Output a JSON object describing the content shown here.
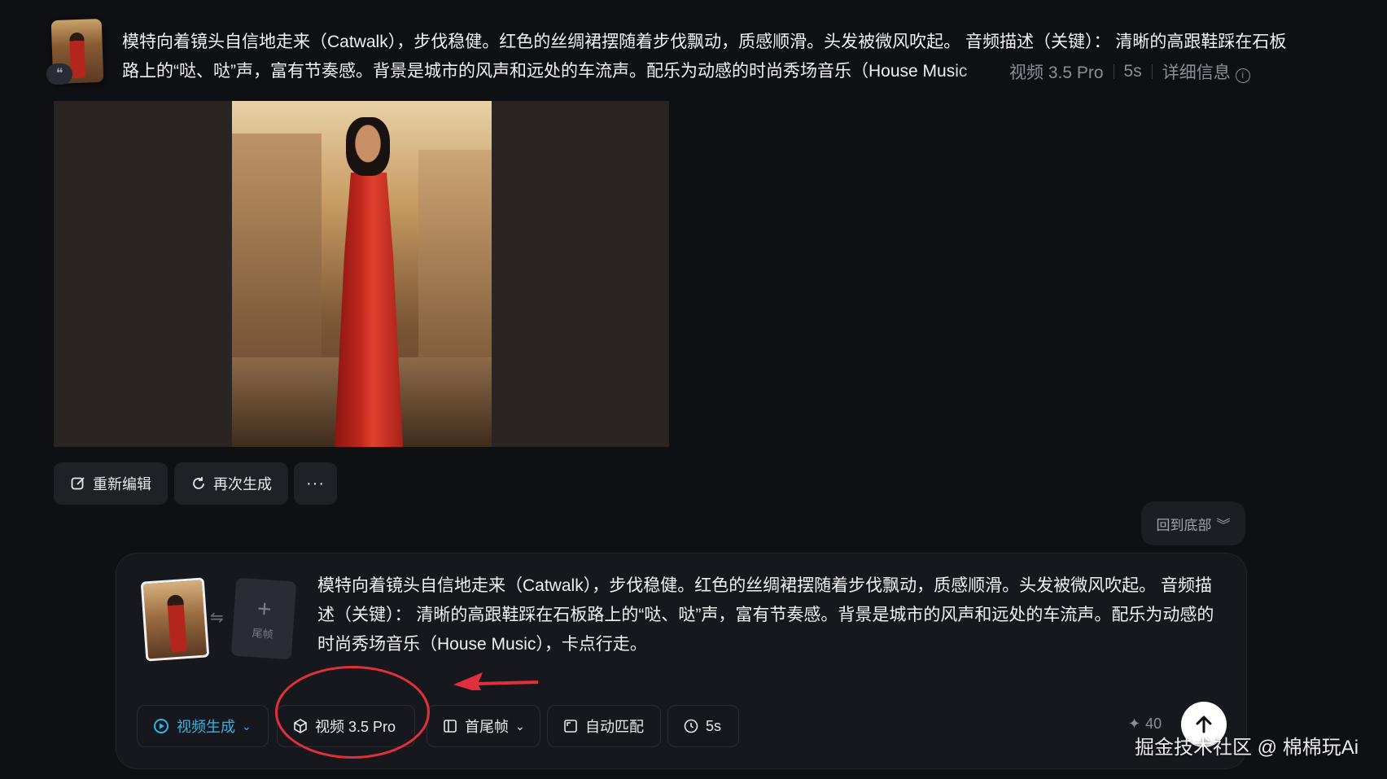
{
  "history": {
    "quote_icon": "quote-icon",
    "prompt": "模特向着镜头自信地走来（Catwalk），步伐稳健。红色的丝绸裙摆随着步伐飘动，质感顺滑。头发被微风吹起。 音频描述（关键）： 清晰的高跟鞋踩在石板路上的“哒、哒”声，富有节奏感。背景是城市的风声和远处的车流声。配乐为动感的时尚秀场音乐（House Music",
    "model": "视频 3.5 Pro",
    "duration": "5s",
    "details_label": "详细信息"
  },
  "actions": {
    "reedit": "重新编辑",
    "regenerate": "再次生成",
    "more": "···"
  },
  "back_to_bottom": "回到底部",
  "composer": {
    "end_frame_label": "尾帧",
    "prompt": "模特向着镜头自信地走来（Catwalk），步伐稳健。红色的丝绸裙摆随着步伐飘动，质感顺滑。头发被微风吹起。 音频描述（关键）： 清晰的高跟鞋踩在石板路上的“哒、哒”声，富有节奏感。背景是城市的风声和远处的车流声。配乐为动感的时尚秀场音乐（House Music），卡点行走。",
    "mode_label": "视频生成",
    "model_label": "视频 3.5 Pro",
    "frames_label": "首尾帧",
    "ratio_label": "自动匹配",
    "duration_label": "5s",
    "credits": "40"
  },
  "watermark": "掘金技术社区 @ 棉棉玩Ai",
  "colors": {
    "background": "#0f1014",
    "accent": "#2fb5e6",
    "annotation": "#e1303b"
  }
}
